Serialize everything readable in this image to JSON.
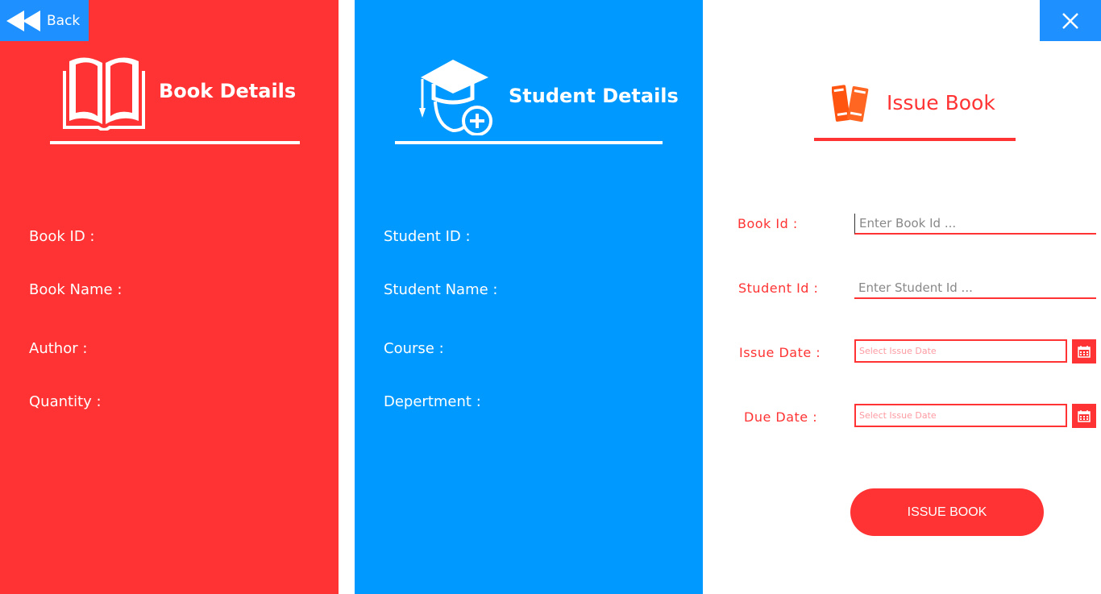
{
  "nav": {
    "back_label": "Back",
    "back_icon": "rewind-icon",
    "close_label": "X"
  },
  "book_panel": {
    "title": "Book Details",
    "icon": "book-icon",
    "fields": [
      {
        "label": "Book ID :"
      },
      {
        "label": "Book Name :"
      },
      {
        "label": "Author :"
      },
      {
        "label": "Quantity :"
      }
    ]
  },
  "student_panel": {
    "title": "Student Details",
    "icon": "graduate-add-icon",
    "fields": [
      {
        "label": "Student ID :"
      },
      {
        "label": "Student Name :"
      },
      {
        "label": "Course :"
      },
      {
        "label": "Depertment :"
      }
    ]
  },
  "issue_panel": {
    "title": "Issue Book",
    "icon": "books-icon",
    "book_id": {
      "label": "Book Id :",
      "value": "",
      "placeholder": "Enter Book Id ..."
    },
    "student_id": {
      "label": "Student Id :",
      "value": "",
      "placeholder": "Enter Student Id ..."
    },
    "issue_date": {
      "label": "Issue Date :",
      "value": "",
      "placeholder": "Select Issue Date"
    },
    "due_date": {
      "label": "Due Date :",
      "value": "",
      "placeholder": "Select Issue Date"
    },
    "calendar_icon": "calendar-icon",
    "submit_label": "ISSUE BOOK"
  },
  "colors": {
    "red": "#ff3333",
    "blue": "#0099ff",
    "nav_blue": "#1e90ff",
    "orange": "#ff5511"
  }
}
